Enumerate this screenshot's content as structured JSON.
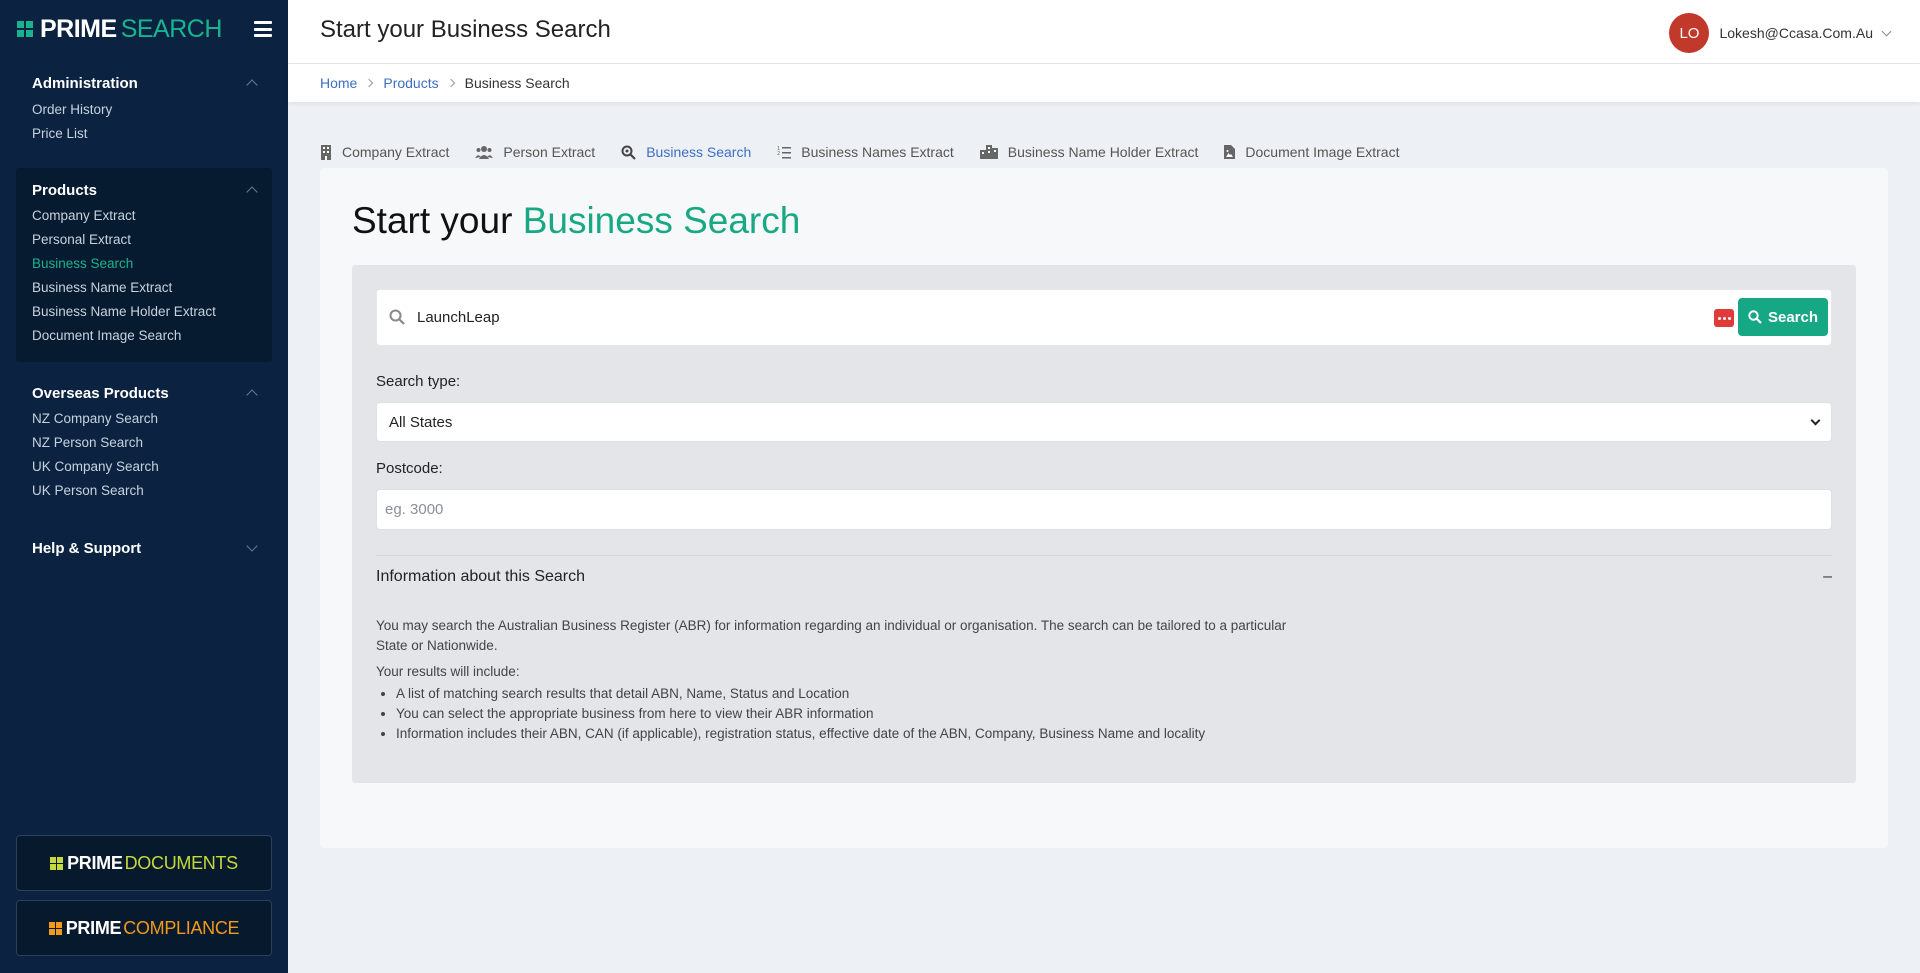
{
  "brand": {
    "bold": "PRIME",
    "light": "SEARCH"
  },
  "header": {
    "title": "Start your Business Search",
    "user_initials": "LO",
    "user_email": "Lokesh@Ccasa.Com.Au"
  },
  "breadcrumb": {
    "home": "Home",
    "products": "Products",
    "current": "Business Search"
  },
  "sidebar": {
    "administration": {
      "label": "Administration",
      "items": [
        "Order History",
        "Price List"
      ]
    },
    "products": {
      "label": "Products",
      "items": [
        "Company Extract",
        "Personal Extract",
        "Business Search",
        "Business Name Extract",
        "Business Name Holder Extract",
        "Document Image Search"
      ]
    },
    "overseas": {
      "label": "Overseas Products",
      "items": [
        "NZ Company Search",
        "NZ Person Search",
        "UK Company Search",
        "UK Person Search"
      ]
    },
    "help": {
      "label": "Help & Support"
    }
  },
  "footer_brands": [
    {
      "bold": "PRIME",
      "light": "DOCUMENTS",
      "color": "#c6d93a"
    },
    {
      "bold": "PRIME",
      "light": "COMPLIANCE",
      "color": "#f29a1b"
    }
  ],
  "tabs": [
    "Company Extract",
    "Person Extract",
    "Business Search",
    "Business Names Extract",
    "Business Name Holder Extract",
    "Document Image Extract"
  ],
  "main": {
    "title_prefix": "Start your",
    "title_accent": "Business Search",
    "search_value": "LaunchLeap",
    "search_button": "Search",
    "search_type_label": "Search type:",
    "search_type_value": "All States",
    "postcode_label": "Postcode:",
    "postcode_placeholder": "eg. 3000",
    "info_title": "Information about this Search",
    "info_toggle": "–",
    "info_text": "You may search the Australian Business Register (ABR) for information regarding an individual or organisation. The search can be tailored to a particular State or Nationwide.",
    "results_intro": "Your results will include:",
    "results": [
      "A list of matching search results that detail ABN, Name, Status and Location",
      "You can select the appropriate business from here to view their ABR information",
      "Information includes their ABN, CAN (if applicable), registration status, effective date of the ABN, Company, Business Name and locality"
    ]
  },
  "colors": {
    "sidebar_bg": "#0b2340",
    "accent_green": "#19b48f",
    "link_blue": "#3d6fc4",
    "avatar_red": "#c0392b"
  }
}
